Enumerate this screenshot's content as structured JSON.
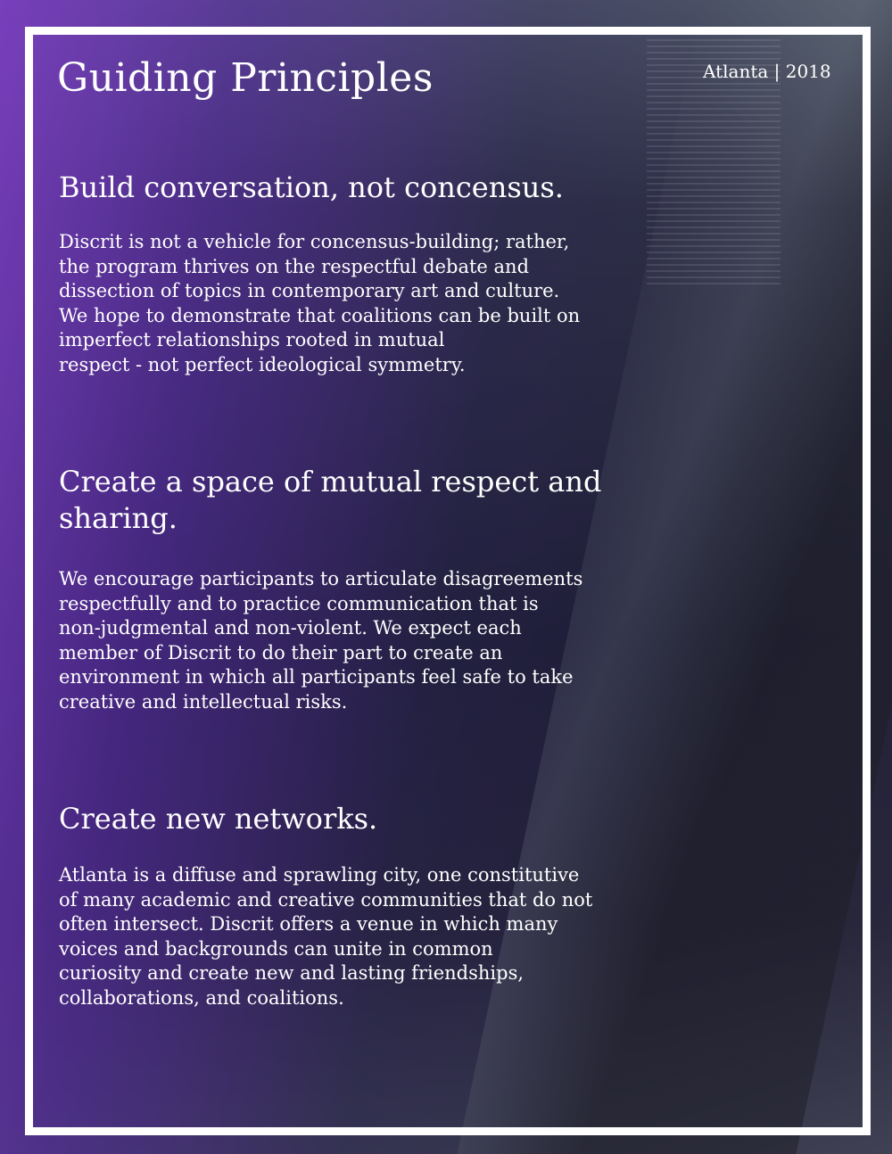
{
  "page": {
    "title": "Guiding Principles",
    "location_year": "Atlanta | 2018"
  },
  "sections": [
    {
      "heading": "Build conversation, not concensus.",
      "body_lines": [
        "Discrit is not a vehicle for concensus-building; rather,",
        "the program thrives on the respectful debate and",
        "dissection of topics in contemporary art and culture.",
        "We hope to demonstrate that coalitions can be built on",
        "imperfect relationships rooted in mutual",
        "respect - not perfect ideological symmetry."
      ]
    },
    {
      "heading_lines": [
        "Create a space of mutual respect and",
        "sharing."
      ],
      "body_lines": [
        "We encourage participants to articulate disagreements",
        "respectfully and to practice communication that is",
        "non-judgmental and non-violent. We expect each",
        "member of Discrit to do their part to create an",
        "environment in which all participants feel safe to take",
        "creative and intellectual risks."
      ]
    },
    {
      "heading": "Create new networks.",
      "body_lines": [
        "Atlanta is a diffuse and sprawling city, one constitutive",
        "of many academic and creative communities that do not",
        "often intersect. Discrit offers a venue in which many",
        "voices and backgrounds can unite in common",
        "curiosity and create new and lasting friendships,",
        "collaborations, and coalitions."
      ]
    }
  ],
  "colors": {
    "text": "#ffffff",
    "frame": "#ffffff",
    "accent_purple": "#7a3cc0"
  }
}
